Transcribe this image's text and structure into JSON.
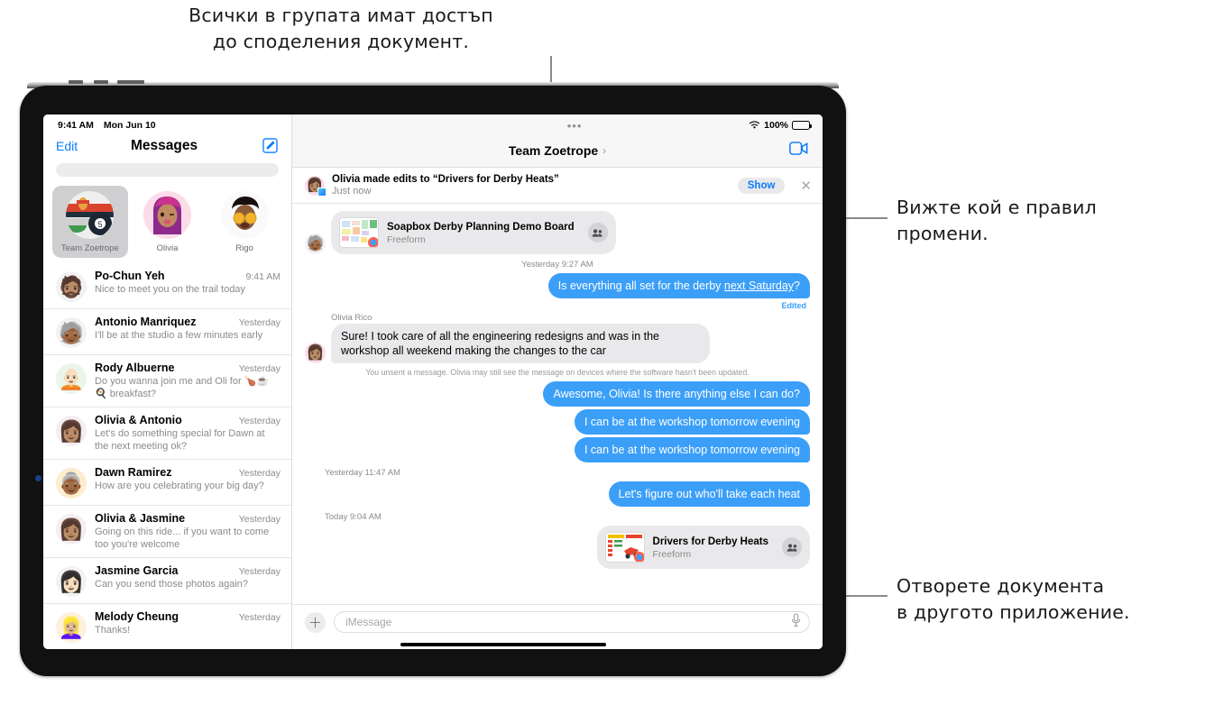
{
  "callouts": {
    "top": "Всички в групата имат достъп\nдо споделения документ.",
    "right_1": "Вижте кой е правил\nпромени.",
    "right_2": "Отворете документа\nв другото приложение."
  },
  "sidebar": {
    "status_time": "9:41 AM",
    "status_date": "Mon Jun 10",
    "edit_label": "Edit",
    "title": "Messages",
    "compose_icon": "compose-icon",
    "search_placeholder": "",
    "pinned": [
      {
        "label": "Team Zoetrope",
        "avatar": "🎱",
        "active": true
      },
      {
        "label": "Olivia",
        "avatar": "👩🏽‍🦱",
        "active": false
      },
      {
        "label": "Rigo",
        "avatar": "🤩",
        "active": false
      }
    ],
    "conversations": [
      {
        "name": "Po-Chun Yeh",
        "time": "9:41 AM",
        "preview": "Nice to meet you on the trail today",
        "avatar": "🧔🏽"
      },
      {
        "name": "Antonio Manriquez",
        "time": "Yesterday",
        "preview": "I'll be at the studio a few minutes early",
        "avatar": "🧓🏾"
      },
      {
        "name": "Rody Albuerne",
        "time": "Yesterday",
        "preview": "Do you wanna join me and Oli for 🍗☕🍳 breakfast?",
        "avatar": "🧑🏻‍🦲"
      },
      {
        "name": "Olivia & Antonio",
        "time": "Yesterday",
        "preview": "Let's do something special for Dawn at the next meeting ok?",
        "avatar": "👩🏽"
      },
      {
        "name": "Dawn Ramirez",
        "time": "Yesterday",
        "preview": "How are you celebrating your big day?",
        "avatar": "👵🏾"
      },
      {
        "name": "Olivia & Jasmine",
        "time": "Yesterday",
        "preview": "Going on this ride... if you want to come too you're welcome",
        "avatar": "👩🏽"
      },
      {
        "name": "Jasmine Garcia",
        "time": "Yesterday",
        "preview": "Can you send those photos again?",
        "avatar": "👩🏻"
      },
      {
        "name": "Melody Cheung",
        "time": "Yesterday",
        "preview": "Thanks!",
        "avatar": "👱🏼‍♀️"
      }
    ]
  },
  "chat": {
    "status_dots": "•••",
    "wifi_icon": "wifi-icon",
    "battery_label": "100%",
    "title": "Team Zoetrope",
    "chevron": "›",
    "facetime_icon": "facetime-video-icon",
    "banner": {
      "avatar": "👩🏽",
      "title": "Olivia made edits to “Drivers for Derby Heats”",
      "subtitle": "Just now",
      "show_label": "Show",
      "close_icon": "✕"
    },
    "doc_top": {
      "title": "Soapbox Derby Planning Demo Board",
      "app": "Freeform",
      "people_icon": "people-icon",
      "avatar": "🧓🏾"
    },
    "timestamps": {
      "t1": "Yesterday 9:27 AM",
      "t2": "Yesterday 11:47 AM",
      "t3": "Today 9:04 AM"
    },
    "messages": [
      {
        "id": "m1",
        "side": "out",
        "text": "Is everything all set for the derby next Saturday?",
        "link": "next Saturday",
        "edited_label": "Edited"
      },
      {
        "id": "m2",
        "side": "in",
        "sender": "Olivia Rico",
        "avatar": "👩🏽",
        "text": "Sure! I took care of all the engineering redesigns and was in the workshop all weekend making the changes to the car"
      },
      {
        "id": "m3",
        "side": "out",
        "text": "Awesome, Olivia! Is there anything else I can do?"
      },
      {
        "id": "m4",
        "side": "out",
        "text": "I can be at the workshop tomorrow evening"
      },
      {
        "id": "m5",
        "side": "out",
        "text": "I can be at the workshop tomorrow evening"
      },
      {
        "id": "m6",
        "side": "out",
        "text": "Let's figure out who'll take each heat"
      }
    ],
    "unsent_notice": "You unsent a message. Olivia may still see the message on devices where the software hasn't been updated.",
    "doc_bottom": {
      "title": "Drivers for Derby Heats",
      "app": "Freeform",
      "people_icon": "people-icon"
    },
    "input": {
      "plus_icon": "＋",
      "placeholder": "iMessage",
      "mic_icon": "microphone-icon"
    }
  },
  "colors": {
    "imessage_blue": "#3b9ff8",
    "accent_blue": "#0a7cff",
    "bubble_gray": "#e9e9eb"
  }
}
